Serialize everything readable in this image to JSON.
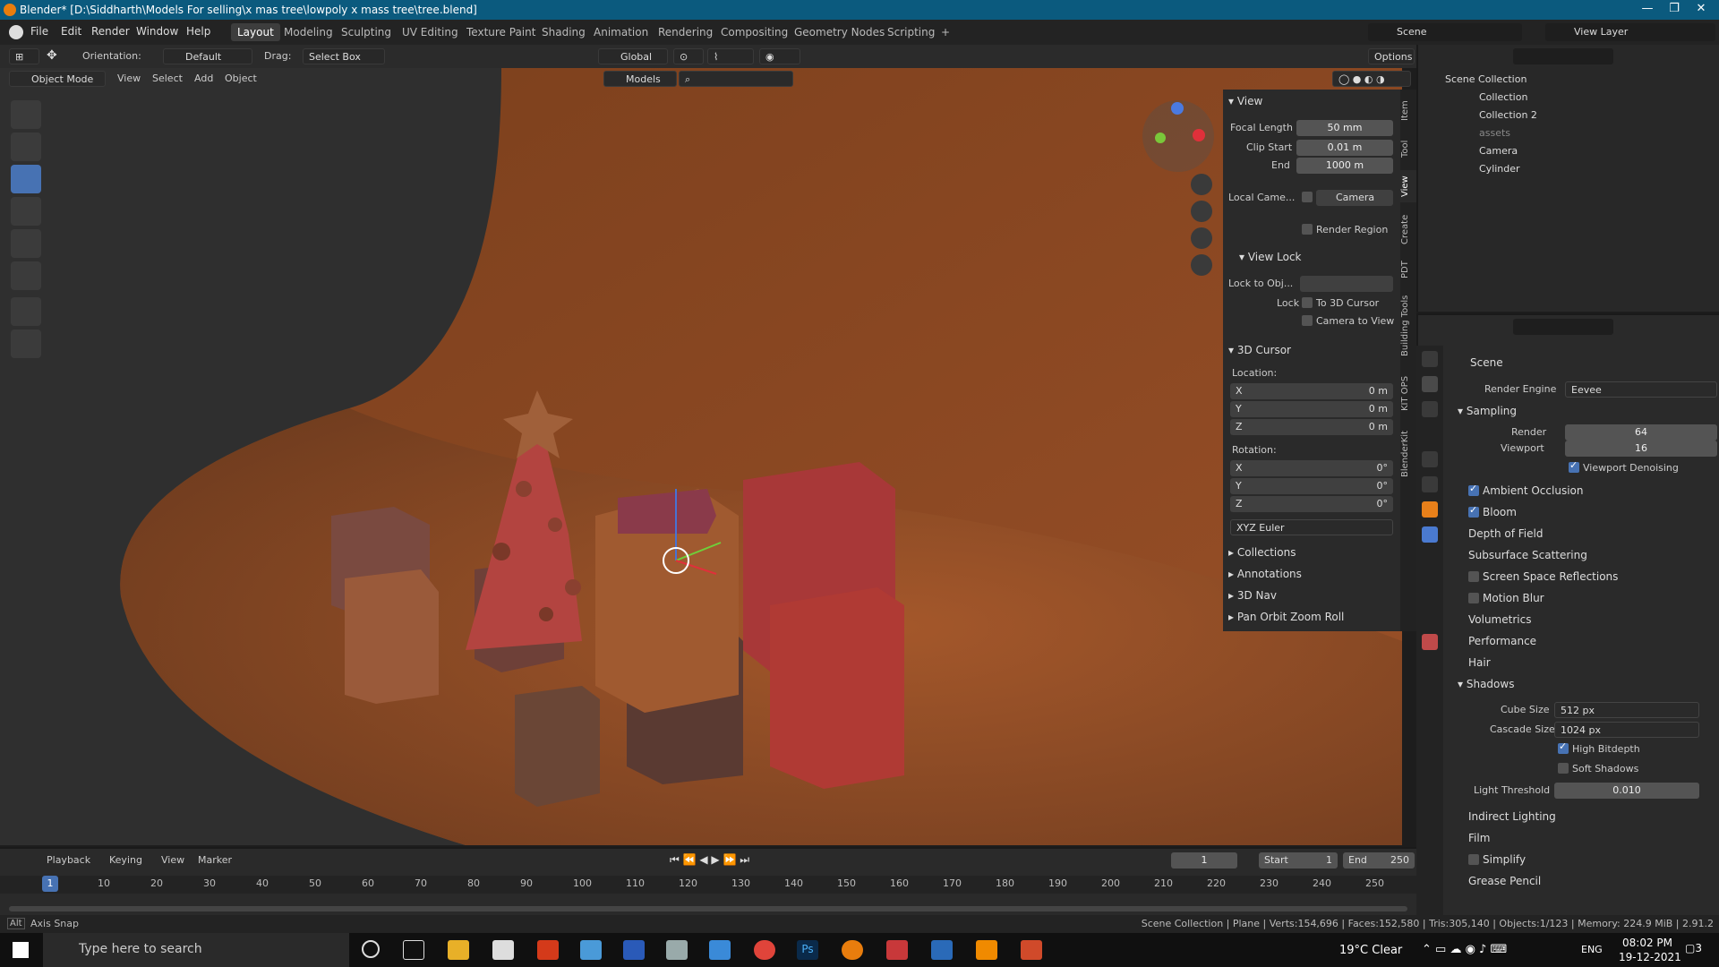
{
  "window": {
    "title": "Blender* [D:\\Siddharth\\Models For selling\\x mas tree\\lowpoly x mass tree\\tree.blend]"
  },
  "menu": {
    "items": [
      "File",
      "Edit",
      "Render",
      "Window",
      "Help"
    ]
  },
  "workspaces": [
    "Layout",
    "Modeling",
    "Sculpting",
    "UV Editing",
    "Texture Paint",
    "Shading",
    "Animation",
    "Rendering",
    "Compositing",
    "Geometry Nodes",
    "Scripting"
  ],
  "top_right": {
    "scene": "Scene",
    "view_layer": "View Layer"
  },
  "header": {
    "orientation_label": "Orientation:",
    "orientation_value": "Default",
    "drag_label": "Drag:",
    "drag_value": "Select Box",
    "transform": "Global",
    "options": "Options"
  },
  "header2": {
    "mode": "Object Mode",
    "menus": [
      "View",
      "Select",
      "Add",
      "Object"
    ],
    "collection": "Models"
  },
  "npanel": {
    "view_title": "View",
    "focal_label": "Focal Length",
    "focal_value": "50 mm",
    "clip_start_label": "Clip Start",
    "clip_start_value": "0.01 m",
    "end_label": "End",
    "end_value": "1000 m",
    "local_camera_label": "Local Came...",
    "local_camera_value": "Camera",
    "render_region": "Render Region",
    "view_lock_title": "View Lock",
    "lock_to_obj_label": "Lock to Obj...",
    "lock_label": "Lock",
    "to_3d_cursor": "To 3D Cursor",
    "camera_to_view": "Camera to View",
    "cursor_title": "3D Cursor",
    "location_label": "Location:",
    "loc": [
      {
        "axis": "X",
        "value": "0 m"
      },
      {
        "axis": "Y",
        "value": "0 m"
      },
      {
        "axis": "Z",
        "value": "0 m"
      }
    ],
    "rotation_label": "Rotation:",
    "rot": [
      {
        "axis": "X",
        "value": "0°"
      },
      {
        "axis": "Y",
        "value": "0°"
      },
      {
        "axis": "Z",
        "value": "0°"
      }
    ],
    "rotation_mode": "XYZ Euler",
    "collapsed": [
      "Collections",
      "Annotations",
      "3D Nav",
      "Pan Orbit Zoom Roll"
    ]
  },
  "side_tabs": [
    "Item",
    "Tool",
    "View",
    "Create",
    "PDT",
    "Building Tools",
    "KIT OPS",
    "BlenderKit"
  ],
  "outliner": {
    "root": "Scene Collection",
    "items": [
      "Collection",
      "Collection 2",
      "assets",
      "Camera",
      "Cylinder"
    ]
  },
  "properties": {
    "scene": "Scene",
    "render_engine_label": "Render Engine",
    "render_engine_value": "Eevee",
    "sampling": "Sampling",
    "render_label": "Render",
    "render_value": "64",
    "viewport_label": "Viewport",
    "viewport_value": "16",
    "viewport_denoising": "Viewport Denoising",
    "sections": [
      {
        "label": "Ambient Occlusion",
        "checked": true
      },
      {
        "label": "Bloom",
        "checked": true
      },
      {
        "label": "Depth of Field"
      },
      {
        "label": "Subsurface Scattering"
      },
      {
        "label": "Screen Space Reflections",
        "checked": false
      },
      {
        "label": "Motion Blur",
        "checked": false
      },
      {
        "label": "Volumetrics"
      },
      {
        "label": "Performance"
      },
      {
        "label": "Hair"
      }
    ],
    "shadows": "Shadows",
    "cube_size_label": "Cube Size",
    "cube_size_value": "512 px",
    "cascade_size_label": "Cascade Size",
    "cascade_size_value": "1024 px",
    "high_bitdepth": "High Bitdepth",
    "soft_shadows": "Soft Shadows",
    "light_threshold_label": "Light Threshold",
    "light_threshold_value": "0.010",
    "after": [
      "Indirect Lighting",
      "Film",
      "Simplify",
      "Grease Pencil"
    ]
  },
  "timeline": {
    "menus": [
      "Playback",
      "Keying",
      "View",
      "Marker"
    ],
    "current_frame": "1",
    "start_label": "Start",
    "start_value": "1",
    "end_label": "End",
    "end_value": "250",
    "ticks": [
      "1",
      "10",
      "20",
      "30",
      "40",
      "50",
      "60",
      "70",
      "80",
      "90",
      "100",
      "110",
      "120",
      "130",
      "140",
      "150",
      "160",
      "170",
      "180",
      "190",
      "200",
      "210",
      "220",
      "230",
      "240",
      "250"
    ]
  },
  "status": {
    "left_key": "Alt",
    "left": "Axis Snap",
    "right": "Scene Collection | Plane | Verts:154,696 | Faces:152,580 | Tris:305,140 | Objects:1/123 | Memory: 224.9 MiB | 2.91.2"
  },
  "taskbar": {
    "search_placeholder": "Type here to search",
    "weather": "19°C  Clear",
    "lang": "ENG",
    "time": "08:02 PM",
    "date": "19-12-2021",
    "notifications": "3"
  },
  "colors": {
    "accent": "#4772b3",
    "titlebar": "#0b5a7e",
    "floor": "#8a4a25"
  }
}
